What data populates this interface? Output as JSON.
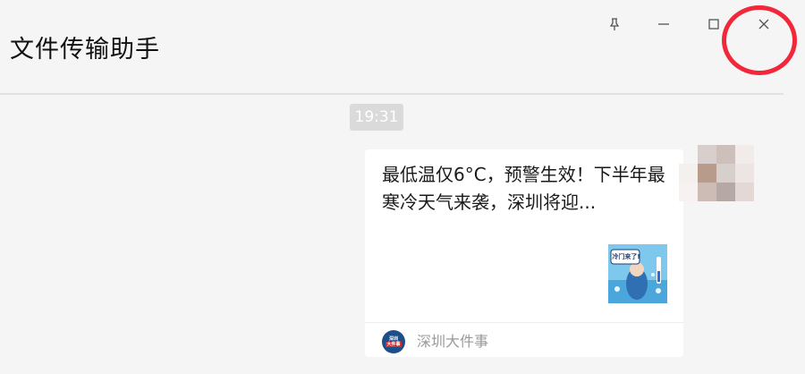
{
  "header": {
    "title": "文件传输助手"
  },
  "window_controls": {
    "pin_icon": "pin-icon",
    "minimize_icon": "minimize-icon",
    "maximize_icon": "maximize-icon",
    "close_icon": "close-icon",
    "close_glyph": "✕",
    "highlight_color": "#f0283a"
  },
  "chat": {
    "timestamp": "19:31",
    "message_card": {
      "title": "最低温仅6°C，预警生效！下半年最寒冷天气来袭，深圳将迎...",
      "thumbnail_caption": "冷门来了!",
      "source_logo_line1": "深圳",
      "source_logo_line2": "大件事",
      "source_name": "深圳大件事"
    },
    "avatar_icon": "user-avatar-icon"
  },
  "colors": {
    "background": "#f5f5f5",
    "card": "#ffffff",
    "timestamp_bg": "#dadada",
    "accent_red": "#f0283a"
  }
}
